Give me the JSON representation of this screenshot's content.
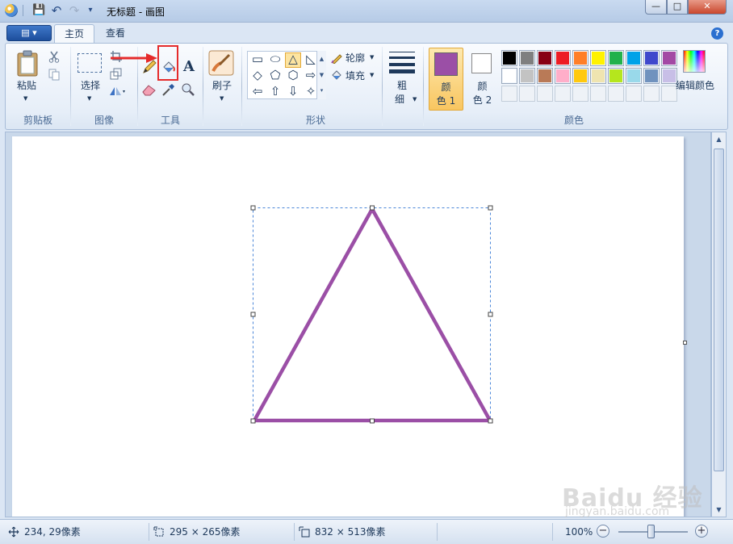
{
  "window": {
    "title": "无标题 - 画图",
    "controls": {
      "minimize": "—",
      "maximize": "□",
      "close": "✕"
    }
  },
  "quick_access": [
    {
      "icon": "save-icon",
      "glyph": "💾"
    },
    {
      "icon": "undo-icon",
      "glyph": "↶"
    },
    {
      "icon": "redo-icon",
      "glyph": "↷"
    },
    {
      "icon": "customize-icon",
      "glyph": "▾"
    }
  ],
  "tabs": [
    {
      "label": "主页",
      "active": true
    },
    {
      "label": "查看",
      "active": false
    }
  ],
  "app_menu_label": "▤ ▾",
  "help_label": "?",
  "ribbon": {
    "clipboard": {
      "paste_label": "粘贴",
      "group_label": "剪贴板"
    },
    "image": {
      "select_label": "选择",
      "group_label": "图像"
    },
    "tools": {
      "text_glyph": "A",
      "group_label": "工具",
      "highlighted": "fill-with-color",
      "annotation_color": "#e52b2b"
    },
    "brushes": {
      "label": "刷子"
    },
    "shapes": {
      "outline_label": "轮廓",
      "fill_label": "填充",
      "group_label": "形状",
      "selected": "triangle",
      "gallery": [
        "▭",
        "⬭",
        "△",
        "◺",
        "◇",
        "⬠",
        "⬡",
        "⇨",
        "⇦",
        "⇧",
        "⇩",
        "✧"
      ]
    },
    "size": {
      "label_top": "粗",
      "label_bottom": "细"
    },
    "colors": {
      "color1_label_top": "颜",
      "color1_label_bottom": "色 1",
      "color2_label_top": "颜",
      "color2_label_bottom": "色 2",
      "color1": "#9b4fa6",
      "color2": "#ffffff",
      "edit_label": "编辑颜色",
      "group_label": "颜色",
      "palette_row1": [
        "#000000",
        "#7f7f7f",
        "#880015",
        "#ed1c24",
        "#ff7f27",
        "#fff200",
        "#22b14c",
        "#00a2e8",
        "#3f48cc",
        "#a349a4"
      ],
      "palette_row2": [
        "#ffffff",
        "#c3c3c3",
        "#b97a57",
        "#ffaec9",
        "#ffc90e",
        "#efe4b0",
        "#b5e61d",
        "#99d9ea",
        "#7092be",
        "#c8bfe7"
      ],
      "empty_count": 10
    }
  },
  "canvas": {
    "background": "#ffffff",
    "stroke_color": "#9b4fa6",
    "shape": "triangle"
  },
  "status": {
    "cursor_pos": "234, 29像素",
    "selection_size": "295 × 265像素",
    "image_size": "832 × 513像素",
    "zoom": "100%",
    "zoom_out": "−",
    "zoom_in": "+"
  },
  "watermark": {
    "main": "Baidu 经验",
    "sub": "jingyan.baidu.com"
  }
}
